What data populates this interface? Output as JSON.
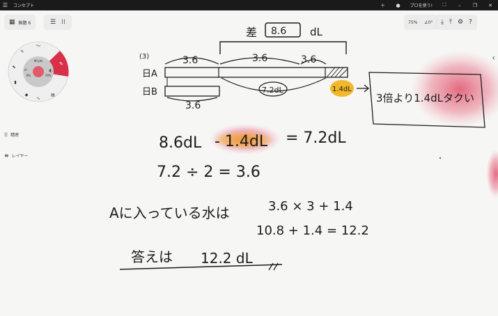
{
  "titlebar": {
    "app_title": "コンセプト",
    "pro_label": "プロを使う!"
  },
  "toolbar": {
    "doc_title": "無題 6",
    "zoom": "75%",
    "rotation": "∠0°"
  },
  "wheel": {
    "brush_size": "90 pts",
    "opacity_left": "0%",
    "opacity_right": "70%",
    "accent_color": "#d9304a"
  },
  "side": {
    "precision_label": "精密",
    "layers_label": "レイヤー"
  },
  "ink": {
    "problem_no": "(3)",
    "diff_label": "差",
    "diff_value": "8.6",
    "diff_unit": "dL",
    "seg_a1": "3.6",
    "seg_a2": "3.6",
    "seg_a3": "3.6",
    "seg_b": "3.6",
    "row_a": "日A",
    "row_b": "日B",
    "circled": "7.2dL",
    "highlight_small": "1.4dL",
    "box_note": "3倍より1.4dLタクい",
    "eq1_left": "8.6dL",
    "eq1_mid": "- 1.4dL",
    "eq1_right": "= 7.2dL",
    "eq2": "7.2 ÷ 2 = 3.6",
    "eq3_label": "Aに入っている水は",
    "eq3_expr": "3.6 × 3 + 1.4",
    "eq4": "10.8 + 1.4 = 12.2",
    "answer_label": "答えは",
    "answer_value": "12.2 dL"
  }
}
